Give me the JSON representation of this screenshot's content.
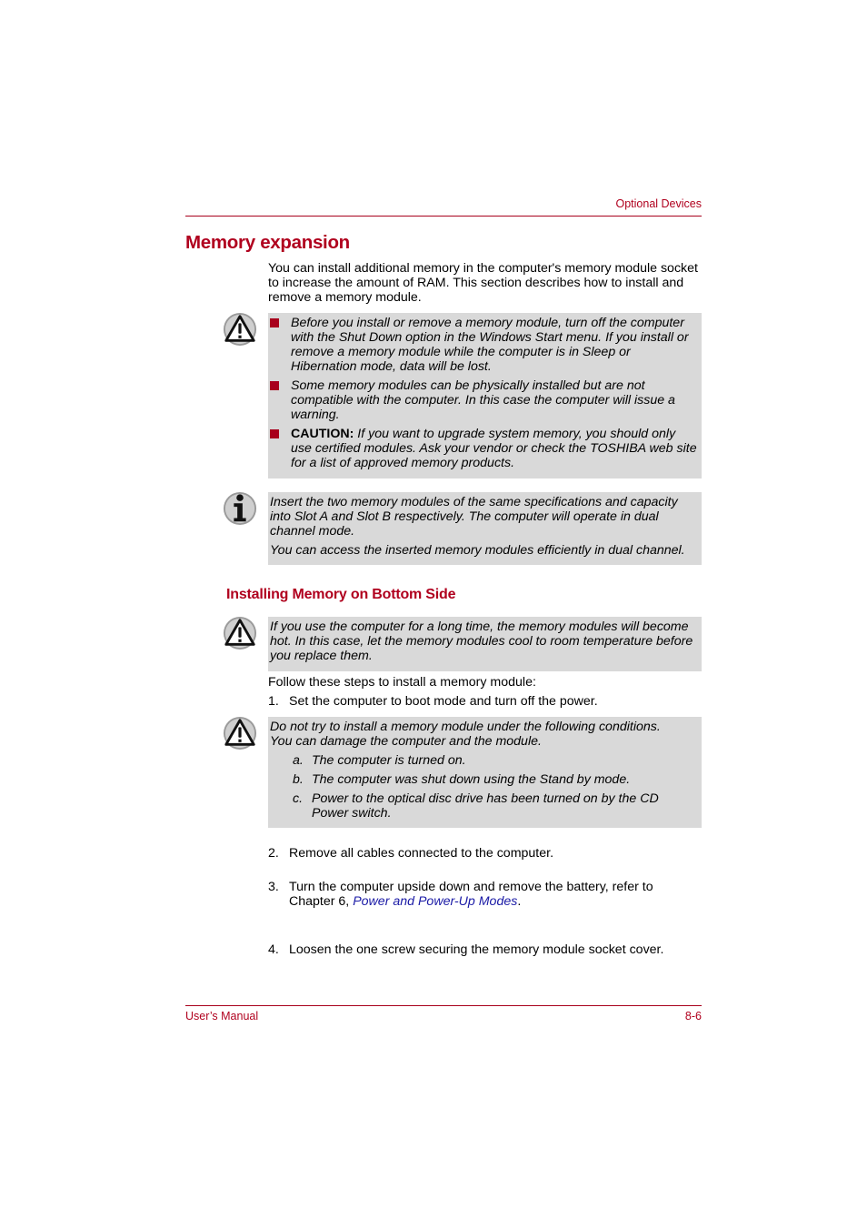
{
  "header": {
    "section": "Optional Devices"
  },
  "title": "Memory expansion",
  "intro": "You can install additional memory in the computer's memory module socket to increase the amount of RAM. This section describes how to install and remove a memory module.",
  "caution_box_1": {
    "icon": "warning-icon",
    "bullets": [
      {
        "bold": "",
        "text": "Before you install or remove a memory module, turn off the computer with the Shut Down option in the Windows Start menu. If you install or remove a memory module while the computer is in Sleep or Hibernation mode, data will be lost."
      },
      {
        "bold": "",
        "text": "Some memory modules can be physically installed but are not compatible with the computer. In this case the computer will issue a warning."
      },
      {
        "bold": "CAUTION:",
        "text": " If you want to upgrade system memory, you should only use certified modules. Ask your vendor or check the TOSHIBA web site for a list of approved memory products."
      }
    ]
  },
  "info_box": {
    "icon": "info-icon",
    "paragraphs": [
      "Insert the two memory modules of the same specifications and capacity into Slot A and Slot B respectively. The computer will operate in dual channel mode.",
      "You can access the inserted memory modules efficiently in dual channel."
    ]
  },
  "subtitle": "Installing Memory on Bottom Side",
  "caution_box_2": {
    "icon": "warning-icon",
    "text": "If you use the computer for a long time, the memory modules will become hot. In this case, let the memory modules cool to room temperature before you replace them."
  },
  "steps_intro": "Follow these steps to install a memory module:",
  "step1": {
    "num": "1.",
    "text": "Set the computer to boot mode and turn off the power."
  },
  "caution_box_3": {
    "icon": "warning-icon",
    "line1": "Do not try to install a memory module under the following conditions.",
    "line2": "You can damage the computer and the module.",
    "items": [
      {
        "label": "a.",
        "text": "The computer is turned on."
      },
      {
        "label": "b.",
        "text": "The computer was shut down using the Stand by mode."
      },
      {
        "label": "c.",
        "text": "Power to the optical disc drive has been turned on by the CD Power switch."
      }
    ]
  },
  "steps": [
    {
      "num": "2.",
      "text": "Remove all cables connected to the computer."
    },
    {
      "num": "3.",
      "text_before": "Turn the computer upside down and remove the battery, refer to Chapter 6, ",
      "link": "Power and Power-Up Modes",
      "text_after": "."
    },
    {
      "num": "4.",
      "text": "Loosen the one screw securing the memory module socket cover."
    }
  ],
  "footer": {
    "left": "User’s Manual",
    "right": "8-6"
  },
  "colors": {
    "accent": "#b0001e",
    "note_bg": "#d9d9d9",
    "link": "#1a1aa6"
  }
}
